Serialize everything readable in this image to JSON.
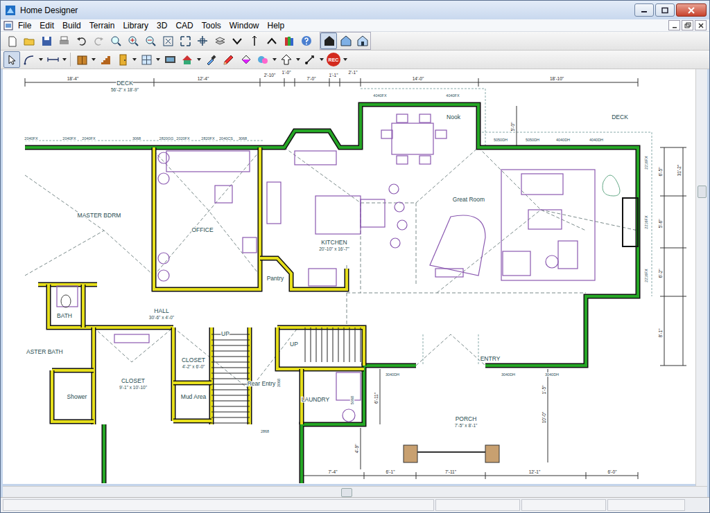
{
  "window": {
    "title": "Home Designer"
  },
  "menu": [
    {
      "label": "File"
    },
    {
      "label": "Edit"
    },
    {
      "label": "Build"
    },
    {
      "label": "Terrain"
    },
    {
      "label": "Library"
    },
    {
      "label": "3D"
    },
    {
      "label": "CAD"
    },
    {
      "label": "Tools"
    },
    {
      "label": "Window"
    },
    {
      "label": "Help"
    }
  ],
  "toolbar": {
    "record_label": "REC",
    "select_tool_selected": true,
    "view_mode_selected": 0
  },
  "plan": {
    "rooms": [
      {
        "label": "DECK",
        "size": "56'-2\" x 18'-9\""
      },
      {
        "label": "MASTER BDRM"
      },
      {
        "label": "OFFICE"
      },
      {
        "label": "KITCHEN",
        "size": "20'-10\" x 16'-7\""
      },
      {
        "label": "Pantry"
      },
      {
        "label": "Nook"
      },
      {
        "label": "Great Room"
      },
      {
        "label": "DECK"
      },
      {
        "label": "HALL",
        "size": "30'-6\" x 4'-0\""
      },
      {
        "label": "BATH"
      },
      {
        "label": "ASTER BATH"
      },
      {
        "label": "CLOSET",
        "size": "4'-2\" x 6'-0\""
      },
      {
        "label": "CLOSET",
        "size": "9'-1\" x 10'-10\""
      },
      {
        "label": "Shower"
      },
      {
        "label": "Mud Area"
      },
      {
        "label": "Rear Entry"
      },
      {
        "label": "UP"
      },
      {
        "label": "UP"
      },
      {
        "label": "LAUNDRY"
      },
      {
        "label": "ENTRY"
      },
      {
        "label": "PORCH",
        "size": "7'-5\" x 8'-1\""
      }
    ],
    "dimensions": [
      "18'-4\"",
      "12'-4\"",
      "2'-10\"",
      "1'-0\"",
      "7'-0\"",
      "1'-1\"",
      "2'-1\"",
      "14'-0\"",
      "18'-10\"",
      "31'-2\"",
      "6'-5\"",
      "5'-6\"",
      "6'-2\"",
      "8'-1\"",
      "5'-0\"",
      "7'-4\"",
      "6'-1\"",
      "7'-11\"",
      "12'-1\"",
      "6'-0\"",
      "10'-0\"",
      "1'-5\"",
      "6'-11\"",
      "4'-9\""
    ],
    "callouts": [
      "2040FX",
      "2040FX",
      "2040FX",
      "3068",
      "2820GG",
      "2020FX",
      "2820FX",
      "2040CS",
      "3068",
      "4040FX",
      "4040FX",
      "5050DH",
      "5050DH",
      "4040DH",
      "4040DH",
      "2216FX",
      "2216FX",
      "2216FX",
      "3040DH",
      "3040DH",
      "3040DH",
      "2868",
      "3068",
      "5068"
    ]
  }
}
